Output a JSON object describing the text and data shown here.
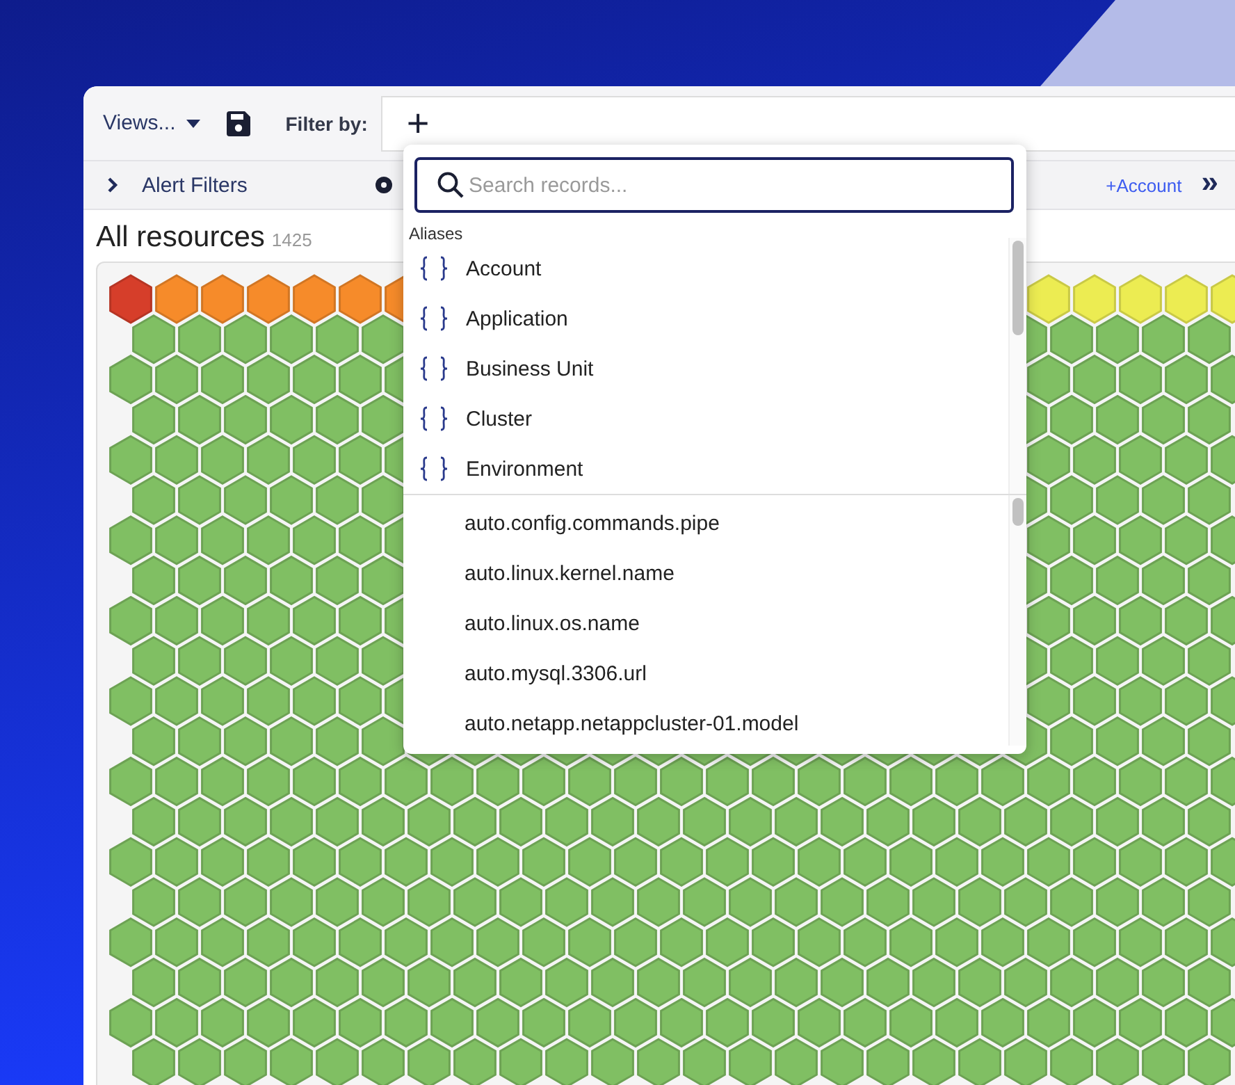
{
  "toolbar": {
    "views_label": "Views...",
    "filter_label": "Filter by:",
    "filter_add": "+"
  },
  "filter_bar": {
    "alert_filters": "Alert Filters",
    "chips": [
      "+Account"
    ],
    "more": "»"
  },
  "resources": {
    "title": "All resources",
    "count": "1425"
  },
  "dropdown": {
    "search_placeholder": "Search records...",
    "section_label": "Aliases",
    "aliases": [
      {
        "label": "Account"
      },
      {
        "label": "Application"
      },
      {
        "label": "Business Unit"
      },
      {
        "label": "Cluster"
      },
      {
        "label": "Environment"
      }
    ],
    "properties": [
      {
        "label": "auto.config.commands.pipe"
      },
      {
        "label": "auto.linux.kernel.name"
      },
      {
        "label": "auto.linux.os.name"
      },
      {
        "label": "auto.mysql.3306.url"
      },
      {
        "label": "auto.netapp.netappcluster-01.model"
      }
    ]
  }
}
